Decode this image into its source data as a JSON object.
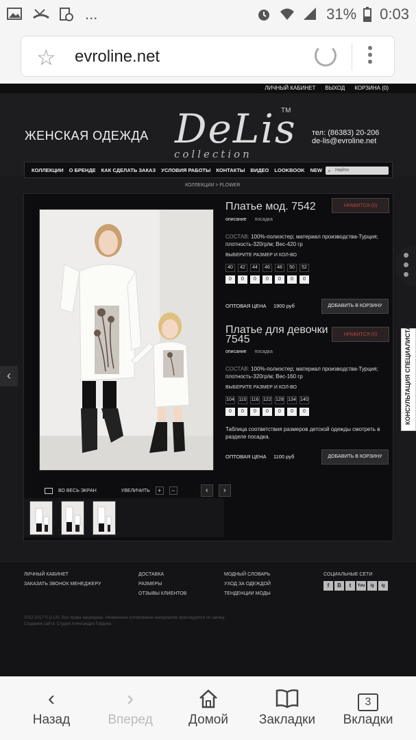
{
  "statusbar": {
    "battery": "31%",
    "time": "0:03",
    "more": "..."
  },
  "browser": {
    "url": "evroline.net"
  },
  "site": {
    "top_links": [
      "ЛИЧНЫЙ КАБИНЕТ",
      "ВЫХОД",
      "КОРЗИНА (0)"
    ],
    "tagline": "ЖЕНСКАЯ ОДЕЖДА",
    "logo": "DeLis",
    "logo_sub": "collection",
    "logo_tm": "TM",
    "phone": "тел: (86383) 20-206",
    "email": "de-lis@evroline.net",
    "nav": [
      "КОЛЛЕКЦИИ",
      "О БРЕНДЕ",
      "КАК СДЕЛАТЬ ЗАКАЗ",
      "УСЛОВИЯ РАБОТЫ",
      "КОНТАКТЫ",
      "ВИДЕО",
      "LOOKBOOK",
      "NEW"
    ],
    "search_placeholder": "Найти",
    "breadcrumb": "КОЛЛЕКЦИИ > FLOWER"
  },
  "product1": {
    "title": "Платье мод. 7542",
    "like": "НРАВИТСЯ (0)",
    "tab_desc": "описание",
    "tab_fit": "посадка",
    "composition_label": "СОСТАВ:",
    "composition": "100%-полиэстер; материал производства-Турция; плотность-320гр/м; Вес-420 гр",
    "size_label": "ВЫБЕРИТЕ РАЗМЕР И КОЛ-ВО",
    "sizes": [
      "40",
      "42",
      "44",
      "46",
      "48",
      "50",
      "52"
    ],
    "qty": [
      "0",
      "0",
      "0",
      "0",
      "0",
      "0",
      "0"
    ],
    "price_label": "ОПТОВАЯ ЦЕНА",
    "price": "1900 руб",
    "cart": "ДОБАВИТЬ В КОРЗИНУ"
  },
  "product2": {
    "title_line1": "Платье для девочки мод.",
    "title_line2": "7545",
    "like": "НРАВИТСЯ (0)",
    "tab_desc": "описание",
    "tab_fit": "посадка",
    "composition_label": "СОСТАВ:",
    "composition": "100%-полиэстер; материал производства-Турция; плотность-320гр/м; Вес-160 гр",
    "size_label": "ВЫБЕРИТЕ РАЗМЕР И КОЛ-ВО",
    "sizes": [
      "104",
      "110",
      "116",
      "122",
      "128",
      "134",
      "140"
    ],
    "qty": [
      "0",
      "0",
      "0",
      "0",
      "0",
      "0",
      "0"
    ],
    "note": "Таблица соответствия размеров детской одежды смотреть в разделе посадка.",
    "price_label": "ОПТОВАЯ ЦЕНА",
    "price": "1100 руб",
    "cart": "ДОБАВИТЬ В КОРЗИНУ"
  },
  "gallery": {
    "fullscreen": "ВО ВЕСЬ ЭКРАН",
    "zoom": "УВЕЛИЧИТЬ",
    "plus": "+",
    "minus": "−"
  },
  "consult": "КОНСУЛЬТАЦИЯ СПЕЦИАЛИСТА",
  "footer": {
    "col1": [
      "ЛИЧНЫЙ КАБИНЕТ",
      "ЗАКАЗАТЬ ЗВОНОК МЕНЕДЖЕРУ"
    ],
    "col2": [
      "ДОСТАВКА",
      "РАЗМЕРЫ",
      "ОТЗЫВЫ КЛИЕНТОВ"
    ],
    "col3": [
      "МОДНЫЙ СЛОВАРЬ",
      "УХОД ЗА ОДЕЖДОЙ",
      "ТЕНДЕНЦИИ МОДЫ"
    ],
    "social_title": "СОЦИАЛЬНЫЕ СЕТИ",
    "social": [
      "f",
      "B",
      "t",
      "You",
      "ig",
      "ig"
    ],
    "copyright1": "2012-2017 © D-LIS. Все права защищены. Незаконное копирование материалов преследуется по закону.",
    "copyright2": "Создание сайта: Студия Александра Гордина"
  },
  "toolbar": {
    "back": "Назад",
    "forward": "Вперед",
    "home": "Домой",
    "bookmarks": "Закладки",
    "tabs": "Вкладки",
    "tab_count": "3"
  }
}
